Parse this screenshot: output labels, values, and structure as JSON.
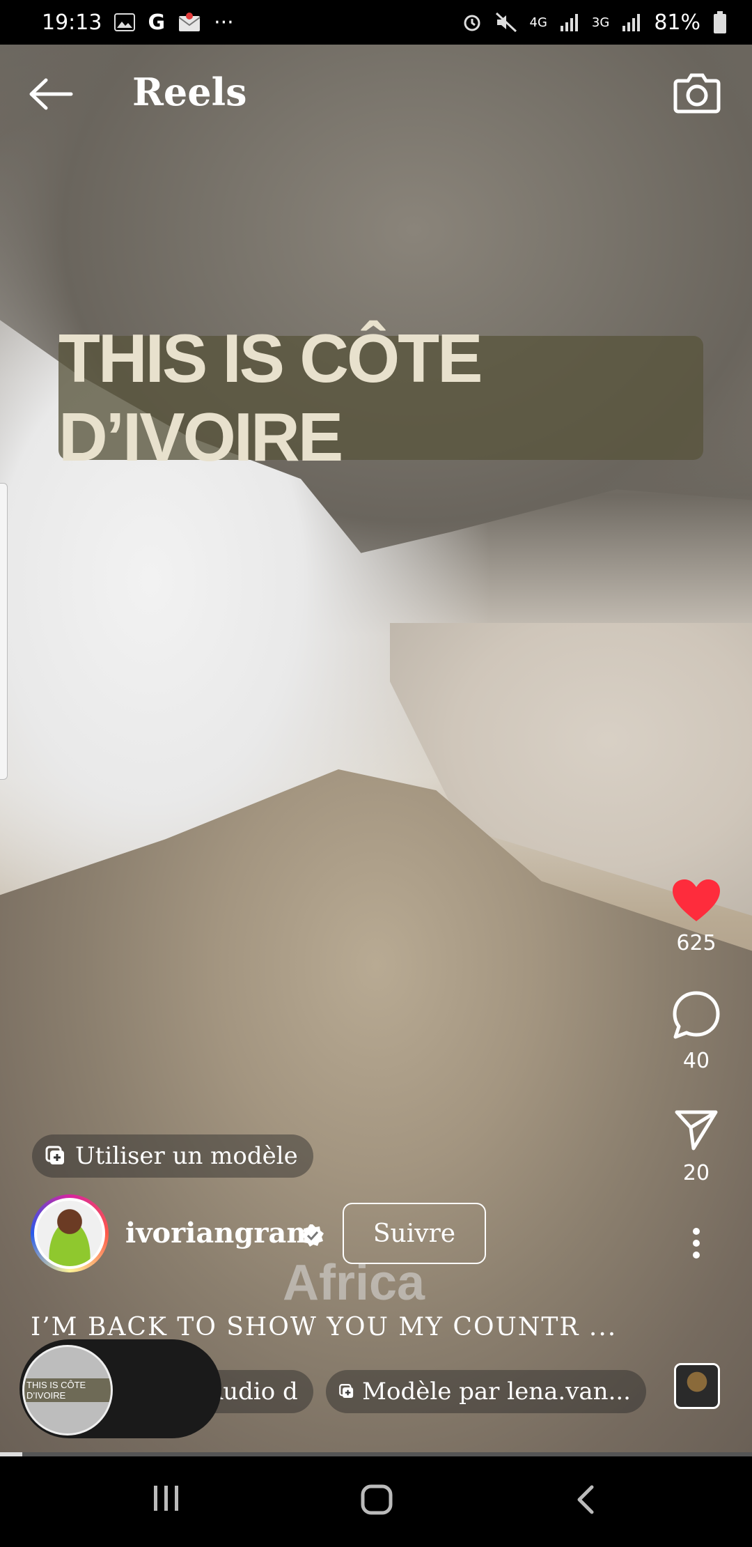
{
  "status_bar": {
    "time": "19:13",
    "g_label": "G",
    "more": "···",
    "net1": "4G",
    "net2": "3G",
    "battery": "81%"
  },
  "header": {
    "title": "Reels"
  },
  "video_overlay": {
    "banner_text": "THIS IS CÔTE D’IVOIRE",
    "watermark": "Africa"
  },
  "actions": {
    "likes": "625",
    "comments": "40",
    "shares": "20"
  },
  "template_chip": {
    "label": "Utiliser un modèle"
  },
  "author": {
    "username": "ivoriangram",
    "follow_label": "Suivre"
  },
  "caption": {
    "text": "I’M BACK TO SHOW YOU MY COUNTR ..."
  },
  "chips": {
    "audio": "ildlife • Audio d",
    "model": "Modèle par lena.van..."
  },
  "pip": {
    "label": "THIS IS CÔTE D’IVOIRE"
  },
  "playback": {
    "progress": 0.03
  },
  "colors": {
    "like": "#fe2c3c",
    "background": "#000000",
    "text": "#ffffff"
  }
}
